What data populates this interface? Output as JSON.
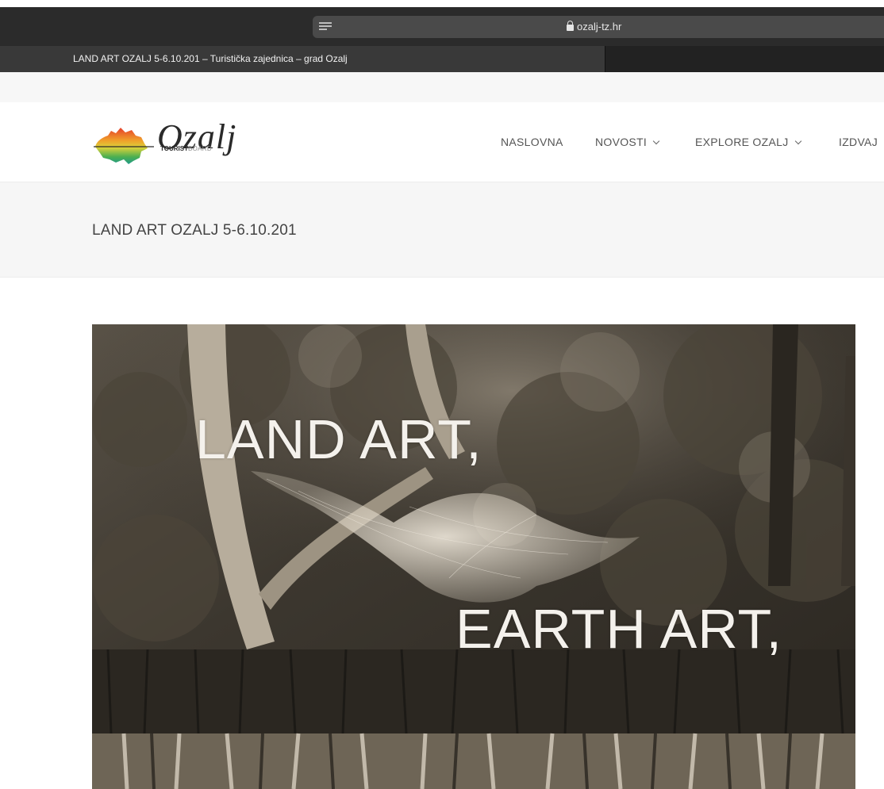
{
  "browser": {
    "url": "ozalj-tz.hr",
    "tab_title": "LAND ART OZALJ 5-6.10.201 – Turistička zajednica – grad Ozalj"
  },
  "site": {
    "logo_script": "Ozalj",
    "logo_sub_bold": "TOURIST",
    "logo_sub_light": "BOARD"
  },
  "nav": {
    "items": [
      {
        "label": "NASLOVNA",
        "has_dropdown": false
      },
      {
        "label": "NOVOSTI",
        "has_dropdown": true
      },
      {
        "label": "EXPLORE OZALJ",
        "has_dropdown": true
      },
      {
        "label": "IZDVAJ",
        "has_dropdown": false
      }
    ]
  },
  "page": {
    "title": "LAND ART OZALJ 5-6.10.201"
  },
  "hero": {
    "line1": "LAND ART,",
    "line2": "EARTH ART,"
  },
  "colors": {
    "chrome_dark": "#2b2b2b",
    "tab_active": "#393939",
    "address_bar": "#4a4a4a",
    "title_band": "#f6f6f6",
    "hero_text": "#f4f1ec",
    "logo_orange": "#e8892b",
    "logo_green": "#4caf50"
  },
  "icons": [
    "reader-icon",
    "lock-icon",
    "reload-icon",
    "chevron-down-icon"
  ]
}
